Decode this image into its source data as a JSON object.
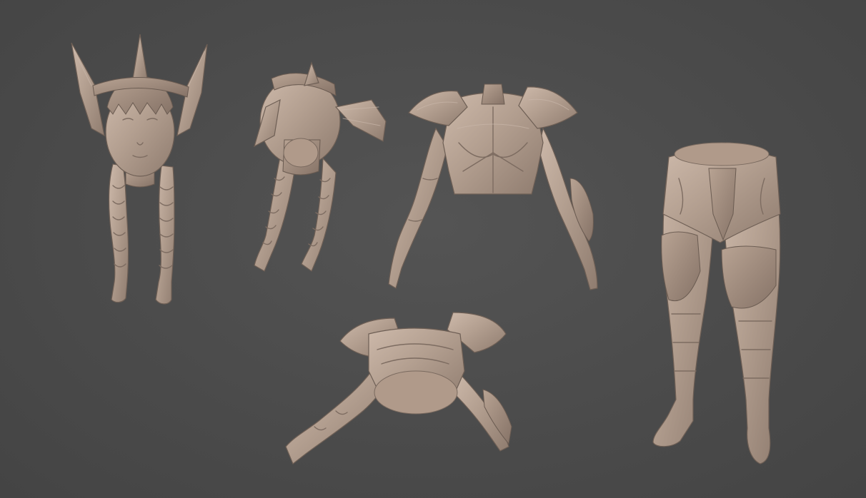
{
  "scene": {
    "background_color": "#4b4b4b",
    "material_color": "#b39f90",
    "parts": [
      {
        "id": "head",
        "icon": "sculpted-head-with-helmet-and-braids"
      },
      {
        "id": "head-bottom",
        "icon": "sculpted-head-bottom-view"
      },
      {
        "id": "torso",
        "icon": "armored-torso-with-arms"
      },
      {
        "id": "torso-bottom",
        "icon": "armored-torso-bottom-view"
      },
      {
        "id": "legs",
        "icon": "armored-legs"
      }
    ]
  }
}
